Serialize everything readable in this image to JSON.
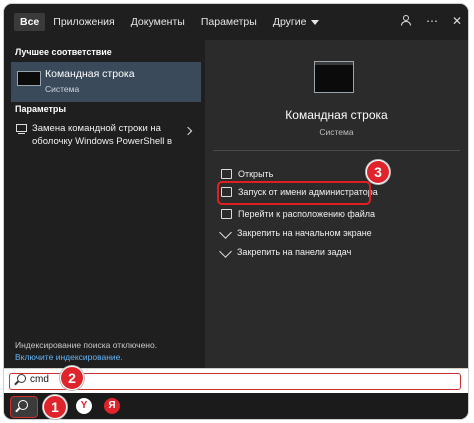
{
  "tabs": [
    {
      "label": "Все"
    },
    {
      "label": "Приложения"
    },
    {
      "label": "Документы"
    },
    {
      "label": "Параметры"
    },
    {
      "label": "Другие"
    }
  ],
  "top_icons": {
    "profile": "person-icon",
    "more": "ellipsis-icon",
    "close": "close-icon"
  },
  "left": {
    "best_match_title": "Лучшее соответствие",
    "best_match": {
      "name": "Командная строка",
      "subtitle": "Система",
      "icon": "cmd-icon"
    },
    "settings_title": "Параметры",
    "setting_item": {
      "label": "Замена командной строки на оболочку Windows PowerShell в",
      "icon": "settings-icon"
    },
    "index_note": "Индексирование поиска отключено.",
    "index_link": "Включите индексирование."
  },
  "right": {
    "app_name": "Командная строка",
    "app_subtitle": "Система",
    "actions": [
      {
        "label": "Открыть",
        "icon": "open-icon"
      },
      {
        "label": "Запуск от имени администратора",
        "icon": "admin-shield-icon"
      },
      {
        "label": "Перейти к расположению файла",
        "icon": "folder-icon"
      },
      {
        "label": "Закрепить на начальном экране",
        "icon": "pin-icon"
      },
      {
        "label": "Закрепить на панели задач",
        "icon": "pin-icon"
      }
    ]
  },
  "search": {
    "value": "cmd"
  },
  "taskbar": {
    "apps": [
      {
        "name": "yandex-browser",
        "glyph": "Y",
        "color": "#ffffff",
        "fg": "#e0242b"
      },
      {
        "name": "yandex",
        "glyph": "Я",
        "color": "#e0242b",
        "fg": "#ffffff"
      }
    ]
  },
  "badges": {
    "one": "1",
    "two": "2",
    "three": "3"
  },
  "colors": {
    "accent_red": "#e0242b",
    "link_blue": "#64b5f6",
    "selected_bg": "#3b4a5a"
  }
}
